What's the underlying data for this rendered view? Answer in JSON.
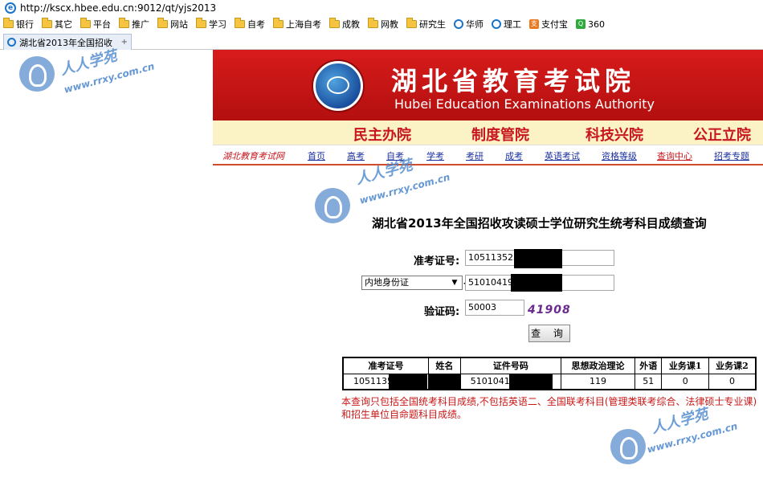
{
  "browser": {
    "url": "http://kscx.hbee.edu.cn:9012/qt/yjs2013",
    "tab_title": "湖北省2013年全国招收",
    "tab_extra": "+",
    "bookmarks": [
      "银行",
      "其它",
      "平台",
      "推广",
      "网站",
      "学习",
      "自考",
      "上海自考",
      "成教",
      "网教",
      "研究生",
      "华师",
      "理工",
      "支付宝",
      "360"
    ]
  },
  "header": {
    "title_cn": "湖北省教育考试院",
    "title_en": "Hubei Education Examinations Authority",
    "slogans": [
      "民主办院",
      "制度管院",
      "科技兴院",
      "公正立院"
    ]
  },
  "nav": {
    "site_name": "湖北教育考试网",
    "items": [
      "首页",
      "高考",
      "自考",
      "学考",
      "考研",
      "成考",
      "英语考试",
      "资格等级",
      "查询中心",
      "招考专题"
    ]
  },
  "query": {
    "title": "湖北省2013年全国招收攻读硕士学位研究生统考科目成绩查询",
    "exam_id_label": "准考证号:",
    "exam_id_value": "105113525",
    "id_type_selected": "内地身份证",
    "id_value": "510104197",
    "captcha_label": "验证码:",
    "captcha_value": "50003",
    "captcha_image_text": "41908",
    "submit_label": "查 询"
  },
  "results": {
    "headers": [
      "准考证号",
      "姓名",
      "证件号码",
      "思想政治理论",
      "外语",
      "业务课1",
      "业务课2"
    ],
    "row": {
      "exam_id": "10511352",
      "name": "",
      "id_number": "510104197",
      "politics": "119",
      "foreign_language": "51",
      "course1": "0",
      "course2": "0"
    }
  },
  "notice": "本查询只包括全国统考科目成绩,不包括英语二、全国联考科目(管理类联考综合、法律硕士专业课)和招生单位自命题科目成绩。",
  "watermark": {
    "cn": "人人学苑",
    "url": "www.rrxy.com.cn"
  },
  "colors": {
    "banner_red": "#c8161d",
    "slogan_bg": "#fbf3c6",
    "link_blue": "#1a2f9e",
    "notice_red": "#c81818",
    "watermark_blue": "#4a86cc"
  }
}
